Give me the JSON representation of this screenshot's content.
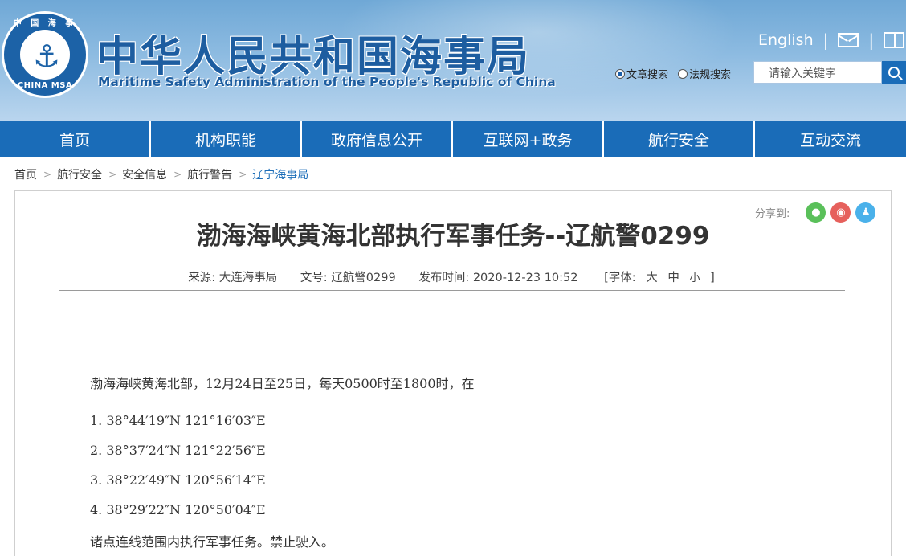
{
  "header": {
    "logo_ring_top": "中 国 海 事",
    "logo_ring_bottom": "CHINA MSA",
    "title": "中华人民共和国海事局",
    "subtitle": "Maritime Safety Administration of the People's Republic of China",
    "english_link": "English",
    "separator": "|",
    "search_options": [
      "文章搜索",
      "法规搜索"
    ],
    "search_selected": "文章搜索",
    "search_placeholder": "请输入关键字"
  },
  "nav": {
    "items": [
      {
        "label": "首页"
      },
      {
        "label": "机构职能"
      },
      {
        "label": "政府信息公开"
      },
      {
        "label": "互联网+政务"
      },
      {
        "label": "航行安全"
      },
      {
        "label": "互动交流"
      }
    ]
  },
  "breadcrumb": [
    "首页",
    "航行安全",
    "安全信息",
    "航行警告",
    "辽宁海事局"
  ],
  "breadcrumb_sep": ">",
  "share": {
    "label": "分享到:"
  },
  "article": {
    "title": "渤海海峡黄海北部执行军事任务--辽航警0299",
    "source": "来源: 大连海事局",
    "doc_no": "文号: 辽航警0299",
    "publish_time": "发布时间: 2020-12-23 10:52",
    "font_label_open": "[字体:",
    "font_sizes": [
      "大",
      "中",
      "小"
    ],
    "font_label_close": "]",
    "intro": "渤海海峡黄海北部，12月24日至25日，每天0500时至1800时，在",
    "points": [
      "1. 38°44′19″N  121°16′03″E",
      "2. 38°37′24″N  121°22′56″E",
      "3. 38°22′49″N  120°56′14″E",
      "4. 38°29′22″N  120°50′04″E"
    ],
    "closing": "诸点连线范围内执行军事任务。禁止驶入。"
  }
}
